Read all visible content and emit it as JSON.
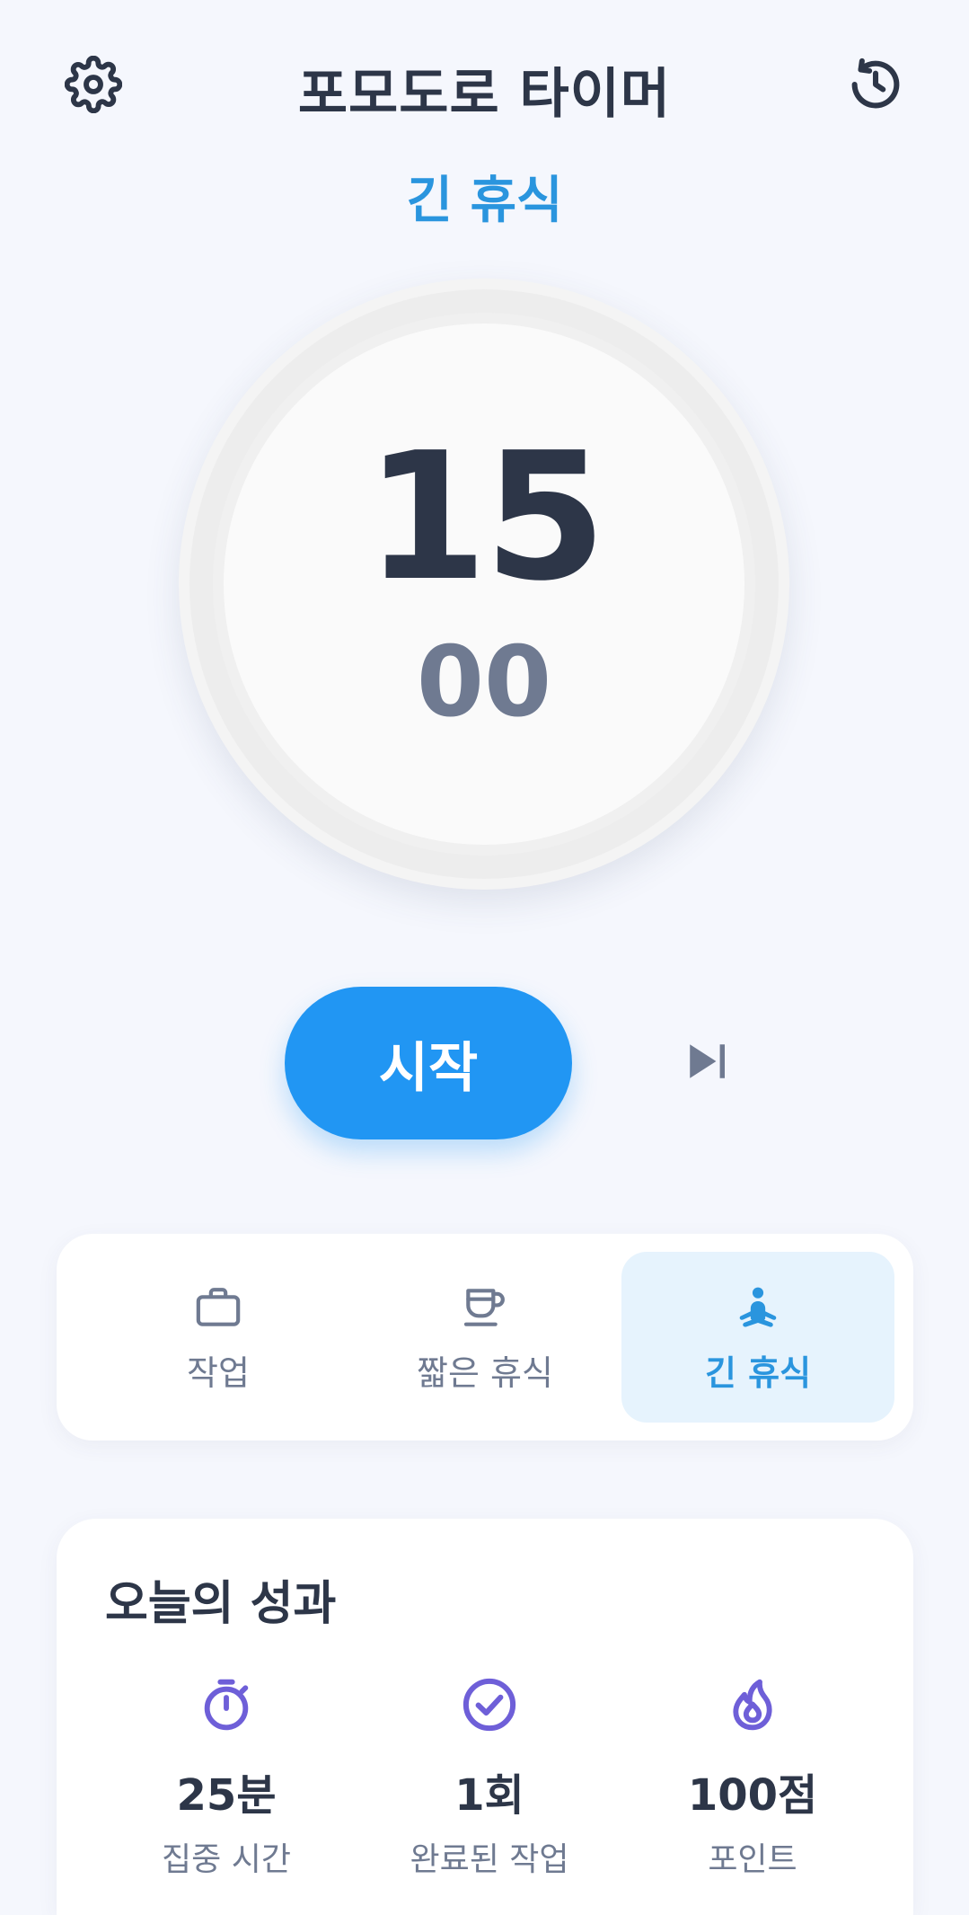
{
  "header": {
    "title": "포모도로 타이머",
    "settings_icon": "gear-icon",
    "history_icon": "history-icon"
  },
  "mode_label": "긴 휴식",
  "timer": {
    "minutes": "15",
    "seconds": "00"
  },
  "controls": {
    "start_label": "시작",
    "skip_icon": "skip-next-icon"
  },
  "modes": [
    {
      "label": "작업",
      "icon": "briefcase-icon",
      "active": false
    },
    {
      "label": "짧은 휴식",
      "icon": "coffee-cup-icon",
      "active": false
    },
    {
      "label": "긴 휴식",
      "icon": "meditation-icon",
      "active": true
    }
  ],
  "stats": {
    "title": "오늘의 성과",
    "items": [
      {
        "value": "25분",
        "label": "집중 시간",
        "icon": "stopwatch-icon"
      },
      {
        "value": "1회",
        "label": "완료된 작업",
        "icon": "check-circle-icon"
      },
      {
        "value": "100점",
        "label": "포인트",
        "icon": "flame-icon"
      }
    ]
  },
  "colors": {
    "accent": "#2196f3",
    "accent_text": "#2a95de",
    "active_tab_bg": "#e6f3fd",
    "stat_icon": "#6e5fd8",
    "text_dark": "#2d3648",
    "text_muted": "#6f7a91",
    "background": "#f5f7fd"
  }
}
